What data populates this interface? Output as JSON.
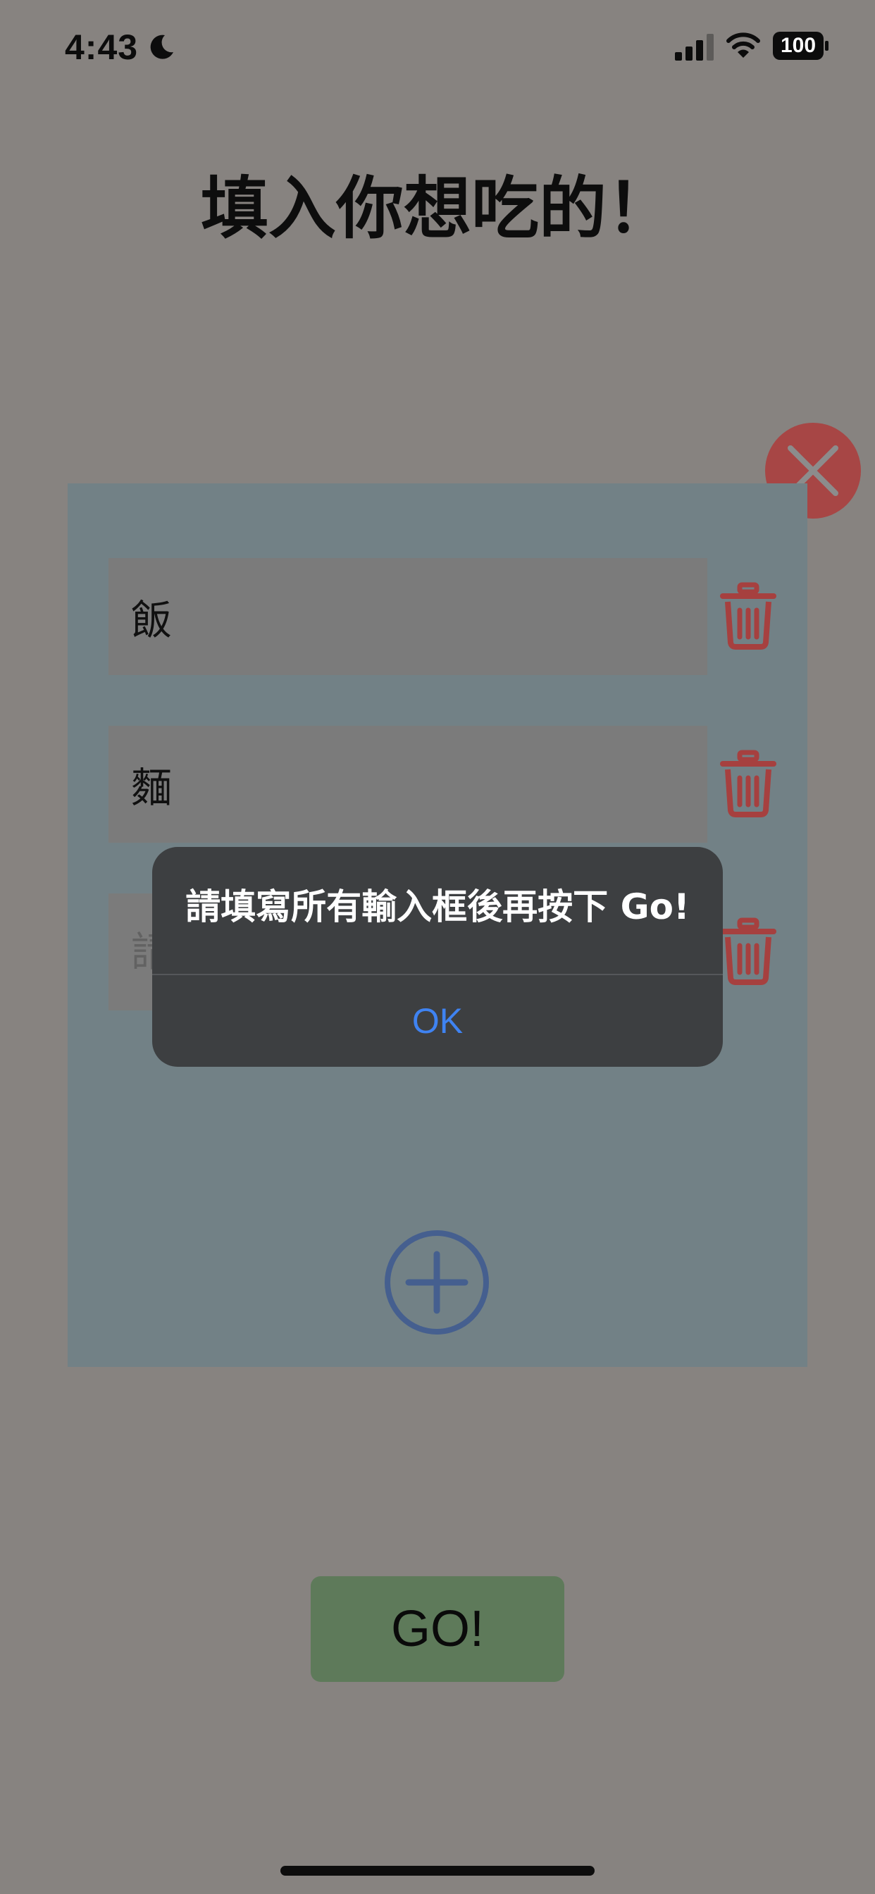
{
  "status_bar": {
    "time": "4:43",
    "battery_level": "100"
  },
  "page": {
    "title": "填入你想吃的！"
  },
  "food_inputs": [
    {
      "value": "飯",
      "placeholder": ""
    },
    {
      "value": "麵",
      "placeholder": ""
    },
    {
      "value": "",
      "placeholder": "請"
    }
  ],
  "go_button": {
    "label": "GO!"
  },
  "alert": {
    "message": "請填寫所有輸入框後再按下 Go!",
    "ok_label": "OK"
  },
  "icons": {
    "moon": "moon-icon",
    "signal": "cellular-signal-icon",
    "wifi": "wifi-icon",
    "battery": "battery-icon",
    "trash": "trash-icon",
    "add": "plus-circle-icon",
    "close": "close-icon"
  },
  "colors": {
    "background": "#878380",
    "card": "#728186",
    "input": "#7b7b7b",
    "trash": "#a6403f",
    "close": "#a74645",
    "add": "#455f8f",
    "go": "#5e7a5a",
    "alert": "#3d3f41",
    "alert_ok": "#3f83f2"
  }
}
